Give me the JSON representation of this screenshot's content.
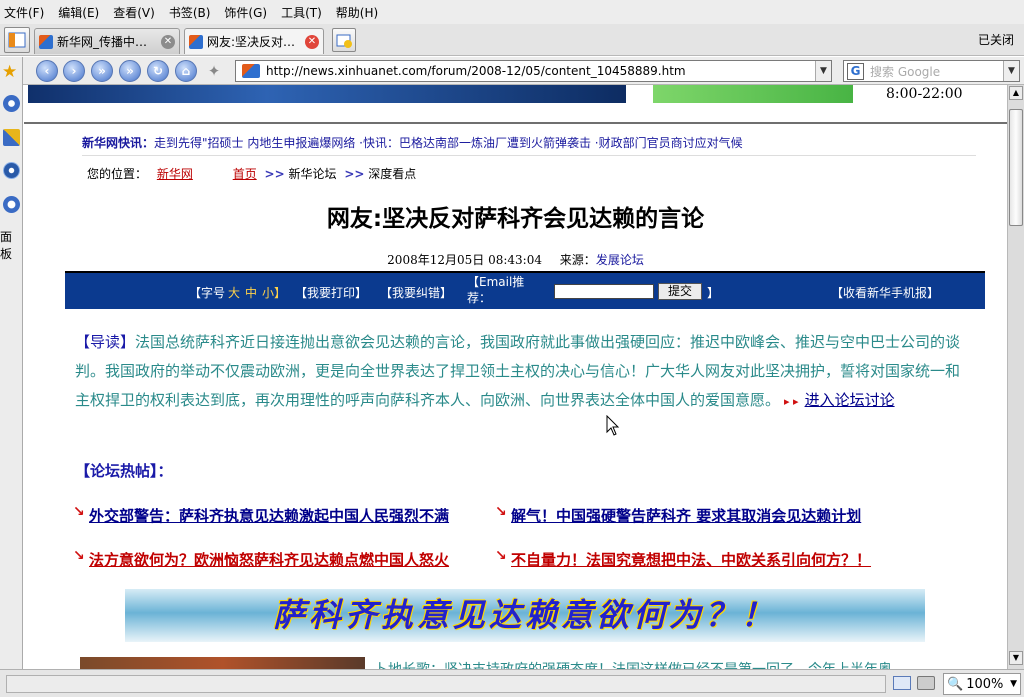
{
  "menu": [
    "文件(F)",
    "编辑(E)",
    "查看(V)",
    "书签(B)",
    "饰件(G)",
    "工具(T)",
    "帮助(H)"
  ],
  "tabs": [
    {
      "label": "新华网_传播中…",
      "active": false
    },
    {
      "label": "网友:坚决反对…",
      "active": true
    }
  ],
  "close_label": "已关闭",
  "url": "http://news.xinhuanet.com/forum/2008-12/05/content_10458889.htm",
  "search_placeholder": "搜索 Google",
  "sidebar_label": "面板",
  "banner": {
    "hours": "8:00-22:00"
  },
  "ticker": {
    "brand": "新华网快讯：",
    "text": "走到先得\"招硕士 内地生申报遍爆网络 ·快讯：巴格达南部一炼油厂遭到火箭弹袭击 ·财政部门官员商讨应对气候"
  },
  "breadcrumb": {
    "label": "您的位置：",
    "site": "新华网",
    "home": "首页",
    "sep1": ">>",
    "forum": "新华论坛",
    "sep2": ">>",
    "section": "深度看点"
  },
  "article": {
    "title_part1": "网友:",
    "title_part2": "坚决反对萨科齐会见达赖的言论",
    "datetime": "2008年12月05日 08:43:04",
    "source_label": "来源：",
    "source": "发展论坛"
  },
  "toolbar": {
    "font_label": "【字号",
    "font_large": "大",
    "font_mid": "中",
    "font_small": "小】",
    "print": "【我要打印】",
    "correct": "【我要纠错】",
    "email_label": "【Email推荐：",
    "submit": "提交",
    "email_close": "】",
    "mobile": "【收看新华手机报】"
  },
  "lead": {
    "tag": "【导读】",
    "text": "法国总统萨科齐近日接连抛出意欲会见达赖的言论，我国政府就此事做出强硬回应：推迟中欧峰会、推迟与空中巴士公司的谈判。我国政府的举动不仅震动欧洲，更是向全世界表达了捍卫领土主权的决心与信心！广大华人网友对此坚决拥护，誓将对国家统一和主权捍卫的权利表达到底，再次用理性的呼声向萨科齐本人、向欧洲、向世界表达全体中国人的爱国意愿。",
    "link": "进入论坛讨论"
  },
  "hot": {
    "label": "【论坛热帖】：",
    "posts": [
      "外交部警告：萨科齐执意见达赖激起中国人民强烈不满",
      "解气！中国强硬警告萨科齐 要求其取消会见达赖计划",
      "法方意欲何为？欧洲恼怒萨科齐见达赖点燃中国人怒火",
      "不自量力！法国究竟想把中法、中欧关系引向何方？！"
    ]
  },
  "slogan": "萨科齐执意见达赖意欲何为？！",
  "bottom_text": "卜地长歌：坚决支持政府的强硬态度！法国这样做已经不是第一回了，今年上半年奥",
  "zoom": "100%",
  "colors": {
    "toolbar_bg": "#0b3a8f",
    "teal": "#2a8a8a",
    "red": "#cc0000",
    "link": "#00008b"
  }
}
